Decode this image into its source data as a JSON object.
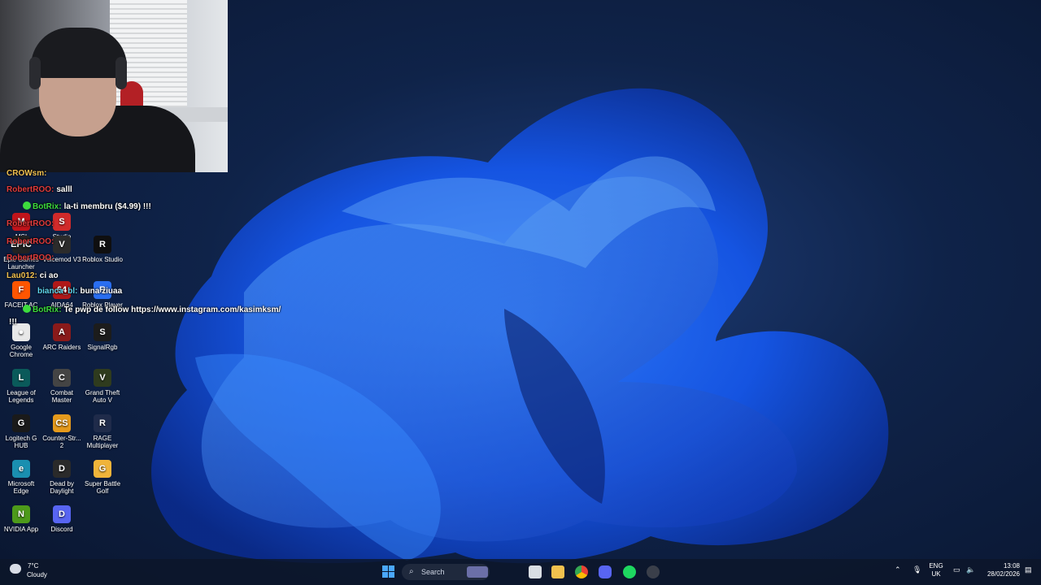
{
  "webcam": {},
  "desktop_icons": [
    {
      "label": "MSI",
      "glyph": "M",
      "color": "#c0141b"
    },
    {
      "label": "Studio",
      "glyph": "S",
      "color": "#d12a2a"
    },
    {
      "label": "Epic Games Launcher",
      "glyph": "EPIC",
      "color": "#222"
    },
    {
      "label": "Voicemod V3",
      "glyph": "V",
      "color": "#2b2b2b"
    },
    {
      "label": "Roblox Studio",
      "glyph": "R",
      "color": "#0f0f10"
    },
    {
      "label": "FACEIT AC",
      "glyph": "F",
      "color": "#ff5500"
    },
    {
      "label": "AIDA64",
      "glyph": "64",
      "color": "#b01818"
    },
    {
      "label": "Roblox Player",
      "glyph": "R",
      "color": "#2a6ef0"
    },
    {
      "label": "Google Chrome",
      "glyph": "●",
      "color": "#e8e8e8"
    },
    {
      "label": "ARC Raiders",
      "glyph": "A",
      "color": "#8a1a1a"
    },
    {
      "label": "SignalRgb",
      "glyph": "S",
      "color": "#1c1c1c"
    },
    {
      "label": "League of Legends",
      "glyph": "L",
      "color": "#0a5a5a"
    },
    {
      "label": "Combat Master",
      "glyph": "C",
      "color": "#444"
    },
    {
      "label": "Grand Theft Auto V",
      "glyph": "V",
      "color": "#2f3b1e"
    },
    {
      "label": "Logitech G HUB",
      "glyph": "G",
      "color": "#1a1a1a"
    },
    {
      "label": "Counter-Str... 2",
      "glyph": "CS",
      "color": "#e59a1c"
    },
    {
      "label": "RAGE Multiplayer",
      "glyph": "R",
      "color": "#1f2b4a"
    },
    {
      "label": "Microsoft Edge",
      "glyph": "e",
      "color": "#1a8fb0"
    },
    {
      "label": "Dead by Daylight",
      "glyph": "D",
      "color": "#2a2a2a"
    },
    {
      "label": "Super Battle Golf",
      "glyph": "G",
      "color": "#f0b43a"
    },
    {
      "label": "NVIDIA App",
      "glyph": "N",
      "color": "#4d9a1a"
    },
    {
      "label": "Discord",
      "glyph": "D",
      "color": "#5865f2"
    }
  ],
  "chat": [
    {
      "user": "CROWsm:",
      "text": "",
      "cls": "nm-yel"
    },
    {
      "user": "RobertROO:",
      "text": "salll",
      "cls": "nm-red"
    },
    {
      "user": "BotRix:",
      "text": "la-ti membru ($4.99) !!!",
      "cls": "nm-green"
    },
    {
      "user": "RobertROO:",
      "text": "",
      "cls": "nm-red"
    },
    {
      "user": "RobertROO:",
      "text": "",
      "cls": "nm-red"
    },
    {
      "user": "RobertROO:",
      "text": "",
      "cls": "nm-red"
    },
    {
      "user": "Lau012:",
      "text": "ci ao",
      "cls": "nm-yel"
    },
    {
      "user": "bianca_bl:",
      "text": "buna ziuaa",
      "cls": "nm-cyan"
    },
    {
      "user": "BotRix:",
      "text": "Te pwp de follow https://www.instagram.com/kasimksm/",
      "cls": "nm-green"
    },
    {
      "user": "",
      "text": "!!!",
      "cls": "nm-yel"
    }
  ],
  "taskbar": {
    "search_placeholder": "Search",
    "weather_temp": "7°C",
    "weather_desc": "Cloudy",
    "lang_1": "ENG",
    "lang_2": "UK",
    "time": "13:08",
    "date": "28/02/2026"
  }
}
